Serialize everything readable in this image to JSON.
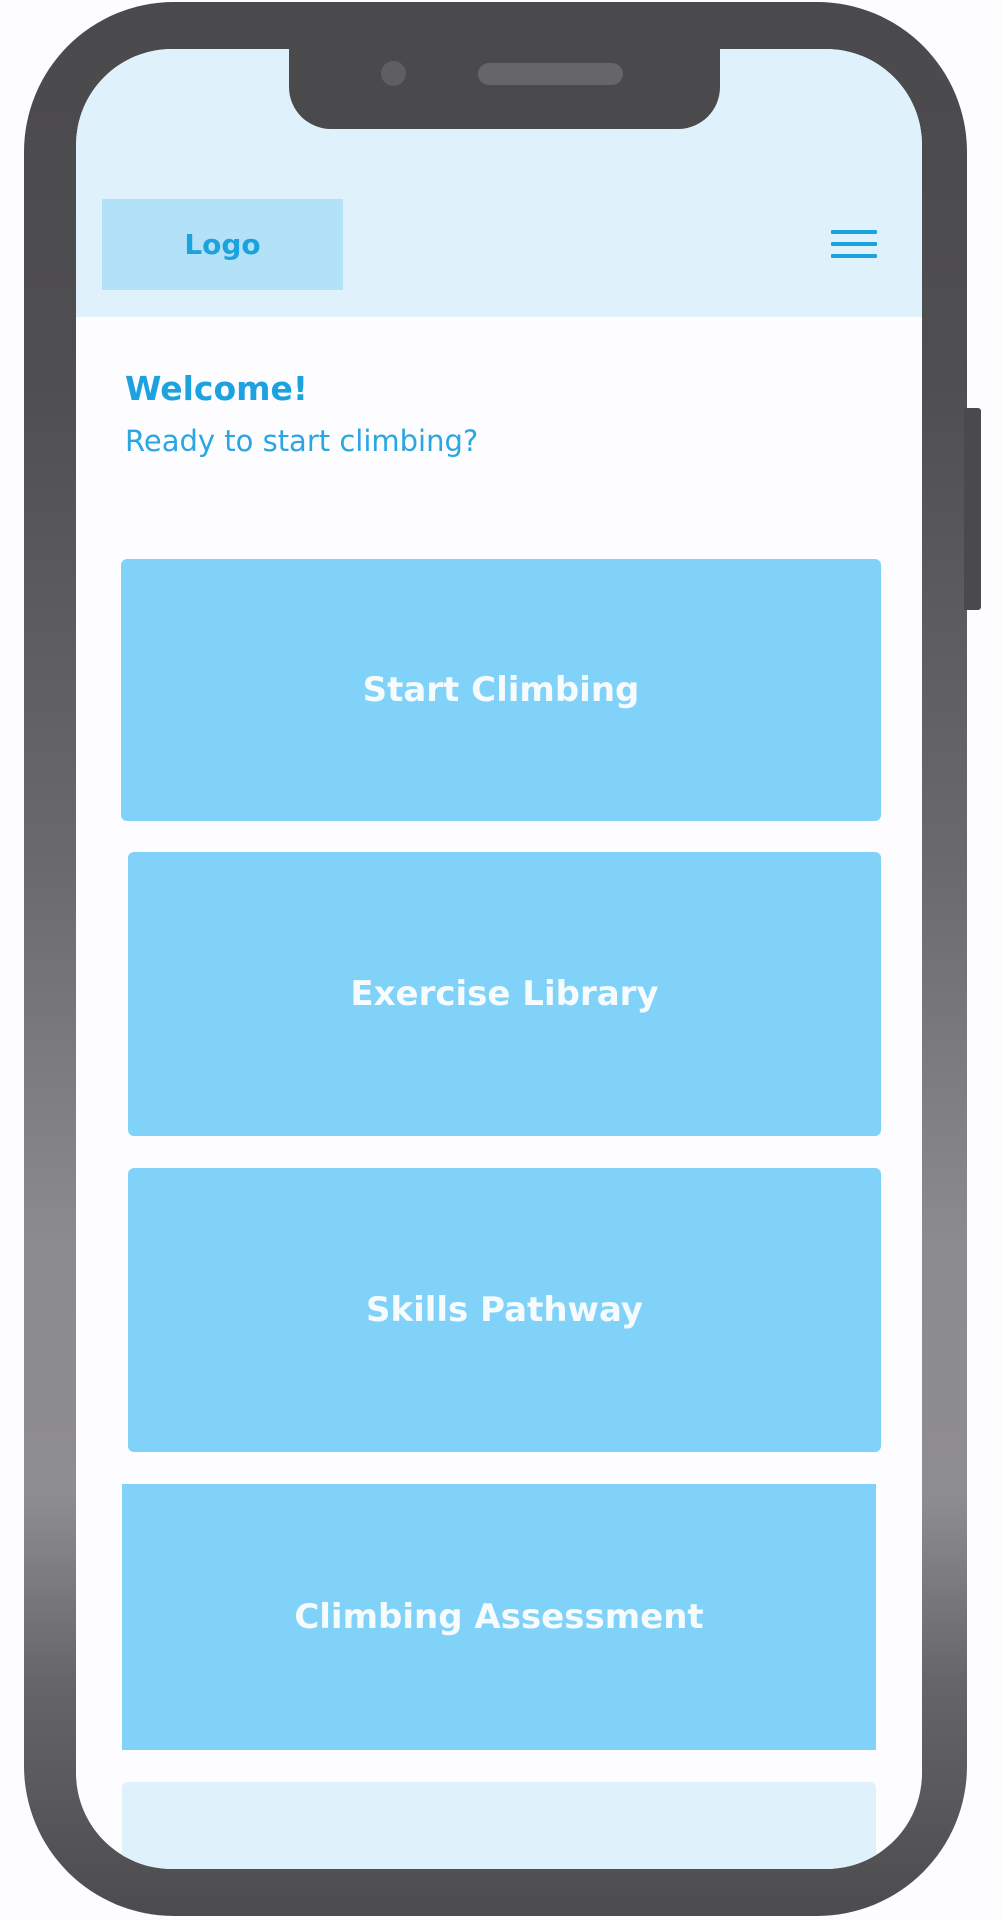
{
  "header": {
    "logo_label": "Logo",
    "menu_icon": "hamburger-menu-icon"
  },
  "welcome": {
    "title": "Welcome!",
    "subtitle": "Ready to start climbing?"
  },
  "tiles": [
    {
      "label": "Start Climbing"
    },
    {
      "label": "Exercise Library"
    },
    {
      "label": "Skills Pathway"
    },
    {
      "label": "Climbing Assessment"
    }
  ],
  "colors": {
    "accent": "#1da2e0",
    "tile_bg": "#80d2f8",
    "header_bg": "#dff1fa",
    "logo_bg": "#b3e2f8",
    "frame": "#4a494c"
  }
}
